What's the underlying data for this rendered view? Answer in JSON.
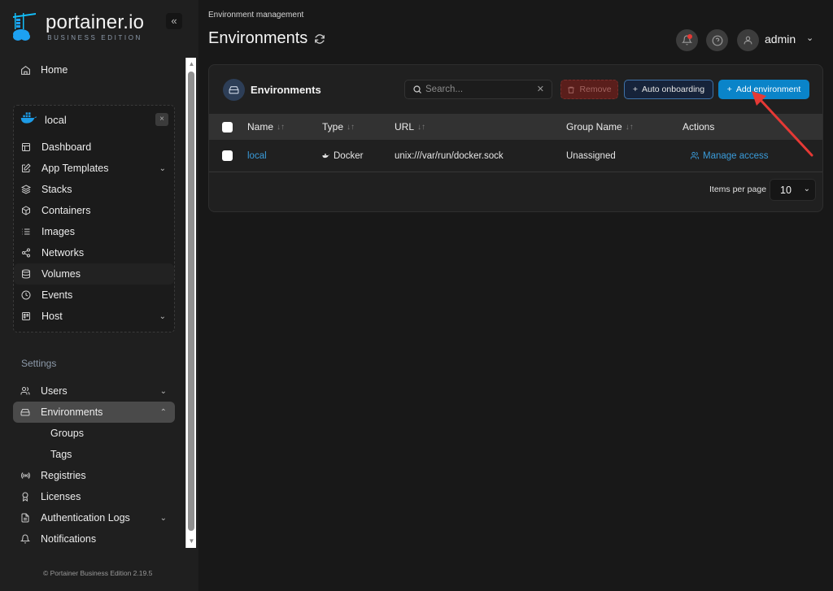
{
  "brand": {
    "name": "portainer.io",
    "edition": "BUSINESS EDITION",
    "collapse_label": "«"
  },
  "sidebar": {
    "home_label": "Home",
    "environment": {
      "name": "local",
      "close_label": "×",
      "items": [
        {
          "label": "Dashboard",
          "icon": "dashboard-icon"
        },
        {
          "label": "App Templates",
          "icon": "edit-icon",
          "expandable": true
        },
        {
          "label": "Stacks",
          "icon": "layers-icon"
        },
        {
          "label": "Containers",
          "icon": "box-icon"
        },
        {
          "label": "Images",
          "icon": "list-icon"
        },
        {
          "label": "Networks",
          "icon": "share-icon"
        },
        {
          "label": "Volumes",
          "icon": "database-icon"
        },
        {
          "label": "Events",
          "icon": "clock-icon"
        },
        {
          "label": "Host",
          "icon": "trello-icon",
          "expandable": true
        }
      ]
    },
    "settings_label": "Settings",
    "settings_items": [
      {
        "label": "Users",
        "icon": "users-icon",
        "expandable": true
      },
      {
        "label": "Environments",
        "icon": "hard-drive-icon",
        "expanded": true,
        "active": true
      },
      {
        "label": "Registries",
        "icon": "radio-icon"
      },
      {
        "label": "Licenses",
        "icon": "award-icon"
      },
      {
        "label": "Authentication Logs",
        "icon": "file-text-icon",
        "expandable": true
      },
      {
        "label": "Notifications",
        "icon": "bell-icon"
      }
    ],
    "environments_sub": [
      "Groups",
      "Tags"
    ],
    "footer": "© Portainer Business Edition  2.19.5"
  },
  "header": {
    "breadcrumb": "Environment management",
    "title": "Environments",
    "user": "admin",
    "notification_alert": true
  },
  "card": {
    "title": "Environments",
    "search_placeholder": "Search...",
    "search_value": "",
    "buttons": {
      "remove": "Remove",
      "auto_onboarding": "Auto onboarding",
      "add_environment": "Add environment"
    },
    "columns": [
      "Name",
      "Type",
      "URL",
      "Group Name",
      "Actions"
    ],
    "sort_glyph": "↓↑",
    "rows": [
      {
        "name": "local",
        "type": "Docker",
        "url": "unix:///var/run/docker.sock",
        "group": "Unassigned",
        "action": "Manage access"
      }
    ],
    "items_per_page_label": "Items per page",
    "items_per_page": "10"
  },
  "annotation": {
    "arrow_color": "#e53935",
    "points_to": "add-environment-button"
  },
  "colors": {
    "accent": "#0a84c9",
    "link": "#3a9bd9",
    "danger": "#5a1e1b"
  }
}
